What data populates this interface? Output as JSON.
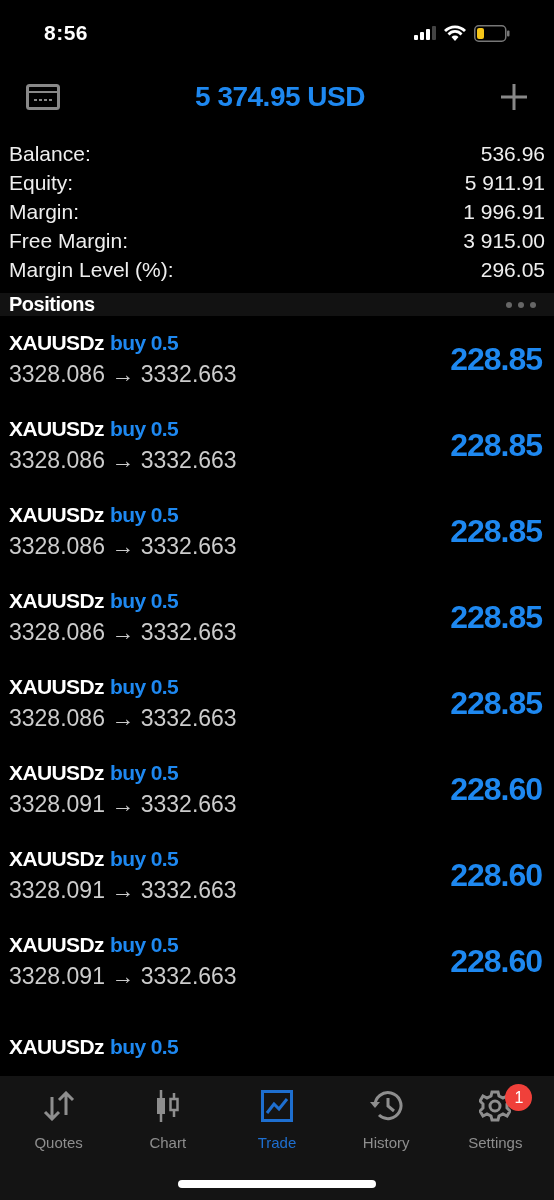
{
  "status_bar": {
    "time": "8:56"
  },
  "header": {
    "equity_title": "5 374.95 USD"
  },
  "summary": [
    {
      "label": "Balance:",
      "value": "536.96"
    },
    {
      "label": "Equity:",
      "value": "5 911.91"
    },
    {
      "label": "Margin:",
      "value": "1 996.91"
    },
    {
      "label": "Free Margin:",
      "value": "3 915.00"
    },
    {
      "label": "Margin Level (%):",
      "value": "296.05"
    }
  ],
  "positions_header": {
    "title": "Positions"
  },
  "positions": [
    {
      "symbol": "XAUUSDz",
      "trade": "buy 0.5",
      "prices": "3328.086 → 3332.663",
      "profit": "228.85"
    },
    {
      "symbol": "XAUUSDz",
      "trade": "buy 0.5",
      "prices": "3328.086 → 3332.663",
      "profit": "228.85"
    },
    {
      "symbol": "XAUUSDz",
      "trade": "buy 0.5",
      "prices": "3328.086 → 3332.663",
      "profit": "228.85"
    },
    {
      "symbol": "XAUUSDz",
      "trade": "buy 0.5",
      "prices": "3328.086 → 3332.663",
      "profit": "228.85"
    },
    {
      "symbol": "XAUUSDz",
      "trade": "buy 0.5",
      "prices": "3328.086 → 3332.663",
      "profit": "228.85"
    },
    {
      "symbol": "XAUUSDz",
      "trade": "buy 0.5",
      "prices": "3328.091 → 3332.663",
      "profit": "228.60"
    },
    {
      "symbol": "XAUUSDz",
      "trade": "buy 0.5",
      "prices": "3328.091 → 3332.663",
      "profit": "228.60"
    },
    {
      "symbol": "XAUUSDz",
      "trade": "buy 0.5",
      "prices": "3328.091 → 3332.663",
      "profit": "228.60"
    },
    {
      "symbol": "XAUUSDz",
      "trade": "buy 0.5"
    }
  ],
  "tab_bar": [
    {
      "label": "Quotes",
      "selected": false
    },
    {
      "label": "Chart",
      "selected": false
    },
    {
      "label": "Trade",
      "selected": true
    },
    {
      "label": "History",
      "selected": false
    },
    {
      "label": "Settings",
      "selected": false,
      "badge": "1"
    }
  ]
}
